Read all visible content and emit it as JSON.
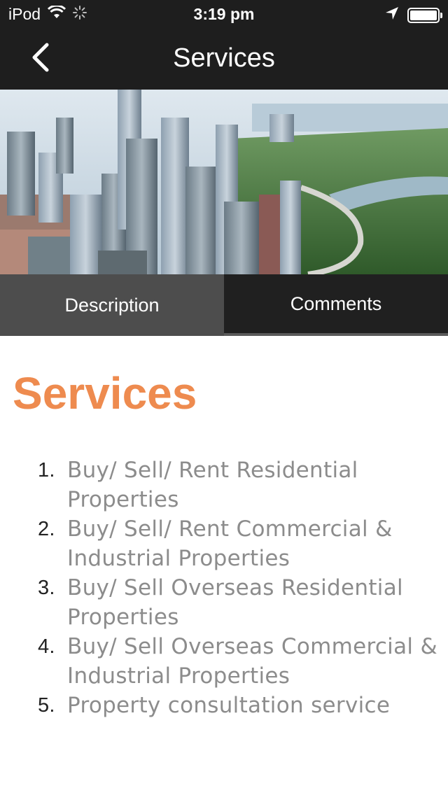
{
  "status_bar": {
    "carrier": "iPod",
    "time": "3:19 pm",
    "icons": [
      "wifi-icon",
      "activity-spinner-icon",
      "location-arrow-icon",
      "battery-icon"
    ]
  },
  "nav": {
    "title": "Services",
    "back_icon": "chevron-left-icon"
  },
  "hero": {
    "description_icon": "city-skyline-image"
  },
  "tabs": [
    {
      "label": "Description",
      "active": true
    },
    {
      "label": "Comments",
      "active": false
    }
  ],
  "content": {
    "title": "Services",
    "title_color": "#ee8b4f",
    "items": [
      {
        "number": "1.",
        "text": "Buy/ Sell/ Rent Residential Properties"
      },
      {
        "number": "2.",
        "text": "Buy/ Sell/ Rent Commercial & Industrial Properties"
      },
      {
        "number": "3.",
        "text": "Buy/ Sell Overseas Residential Properties"
      },
      {
        "number": "4.",
        "text": "Buy/ Sell Overseas Commercial & Industrial Properties"
      },
      {
        "number": "5.",
        "text": "Property consultation service"
      }
    ]
  }
}
